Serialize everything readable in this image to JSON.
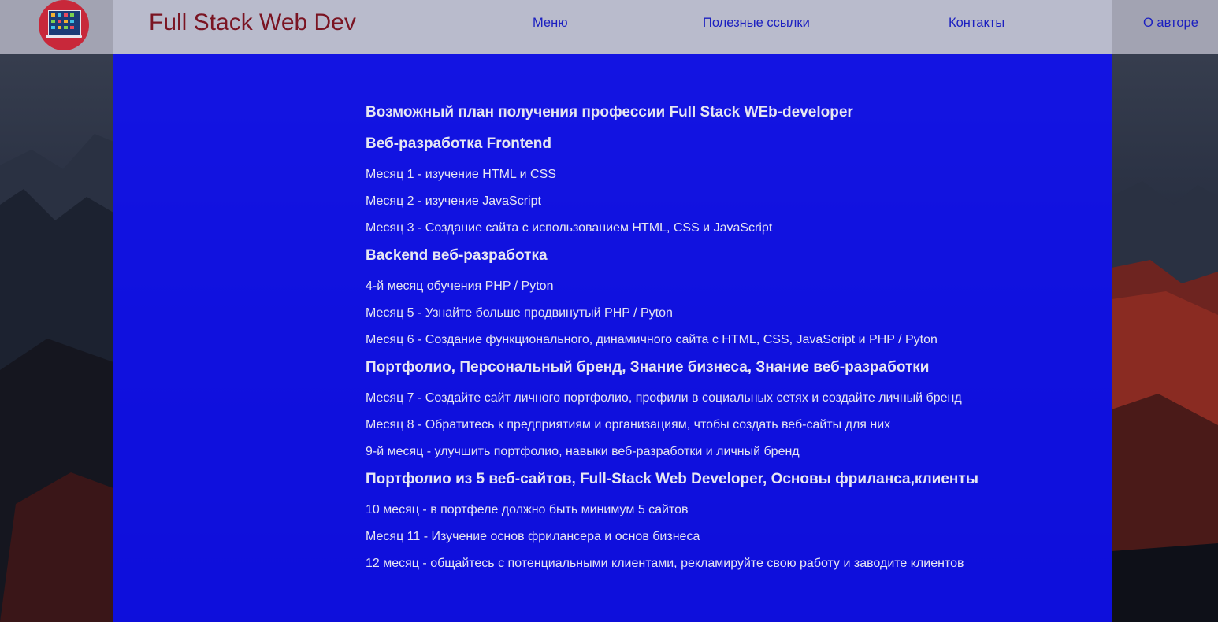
{
  "header": {
    "title": "Full Stack Web Dev",
    "logo_icon": "laptop-apps-icon",
    "nav": [
      {
        "label": "Меню"
      },
      {
        "label": "Полезные ссылки"
      },
      {
        "label": "Контакты"
      },
      {
        "label": "О авторе"
      }
    ]
  },
  "main": {
    "heading": "Возможный план получения профессии Full Stack WEb-developer",
    "sections": [
      {
        "title": "Веб-разработка Frontend",
        "items": [
          "Месяц 1 - изучение HTML и CSS",
          "Месяц 2 - изучение JavaScript",
          "Месяц 3 - Создание сайта с использованием HTML, CSS и JavaScript"
        ]
      },
      {
        "title": "Backend веб-разработка",
        "items": [
          "4-й месяц обучения PHP / Pyton",
          "Месяц 5 - Узнайте больше продвинутый PHP / Pyton",
          "Месяц 6 - Создание функционального, динамичного сайта с HTML, CSS, JavaScript и PHP / Pyton"
        ]
      },
      {
        "title": "Портфолио, Персональный бренд, Знание бизнеса, Знание веб-разработки",
        "items": [
          "Месяц 7 - Создайте сайт личного портфолио, профили в социальных сетях и создайте личный бренд",
          "Месяц 8 - Обратитесь к предприятиям и организациям, чтобы создать веб-сайты для них",
          "9-й месяц - улучшить портфолио, навыки веб-разработки и личный бренд"
        ]
      },
      {
        "title": "Портфолио из 5 веб-сайтов, Full-Stack Web Developer, Основы фриланса,клиенты",
        "items": [
          "10 месяц - в портфеле должно быть минимум 5 сайтов",
          "Месяц 11 - Изучение основ фрилансера и основ бизнеса",
          "12 месяц - общайтесь с потенциальными клиентами, рекламируйте свою работу и заводите клиентов"
        ]
      }
    ]
  },
  "colors": {
    "topbar": "#b9bbcc",
    "title": "#7a1422",
    "nav_link": "#1b1fc0",
    "panel": "#0e0efa",
    "logo": "#c8283a",
    "panel_text": "#e6e6f2"
  }
}
